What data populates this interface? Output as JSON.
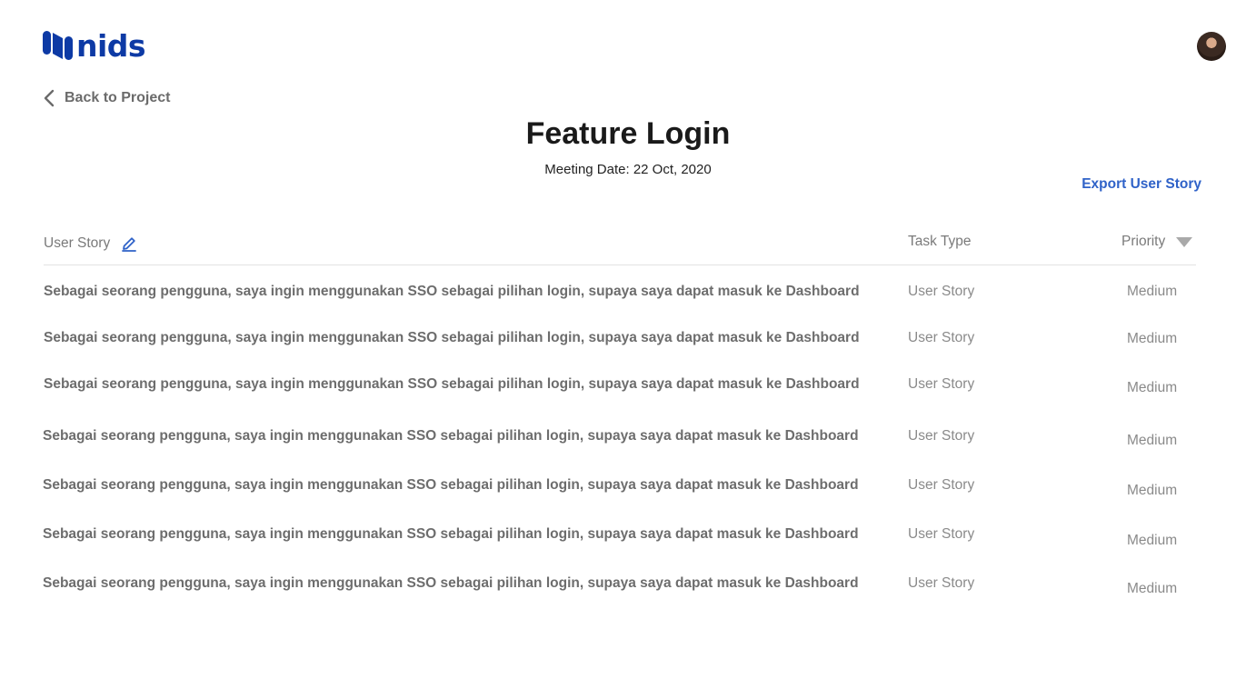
{
  "brand": {
    "name": "nids",
    "color": "#0d3aa5"
  },
  "nav": {
    "back_label": "Back to Project"
  },
  "page": {
    "title": "Feature Login",
    "meeting_date": "Meeting Date: 22 Oct, 2020"
  },
  "actions": {
    "export_label": "Export User Story",
    "accent": "#2f62c8"
  },
  "table": {
    "columns": {
      "story": "User Story",
      "type": "Task Type",
      "priority": "Priority"
    },
    "rows": [
      {
        "story": "Sebagai seorang pengguna, saya ingin menggunakan SSO sebagai pilihan login, supaya saya dapat masuk ke Dashboard",
        "type": "User Story",
        "priority": "Medium"
      },
      {
        "story": "Sebagai seorang pengguna, saya ingin menggunakan SSO sebagai pilihan login, supaya saya dapat masuk ke Dashboard",
        "type": "User Story",
        "priority": "Medium"
      },
      {
        "story": "Sebagai seorang pengguna, saya ingin menggunakan SSO sebagai pilihan login, supaya saya dapat masuk ke Dashboard",
        "type": "User Story",
        "priority": "Medium"
      },
      {
        "story": "Sebagai seorang pengguna, saya ingin menggunakan SSO sebagai pilihan login, supaya saya dapat masuk ke Dashboard",
        "type": "User Story",
        "priority": "Medium"
      },
      {
        "story": "Sebagai seorang pengguna, saya ingin menggunakan SSO sebagai pilihan login, supaya saya dapat masuk ke Dashboard",
        "type": "User Story",
        "priority": "Medium"
      },
      {
        "story": "Sebagai seorang pengguna, saya ingin menggunakan SSO sebagai pilihan login, supaya saya dapat masuk ke Dashboard",
        "type": "User Story",
        "priority": "Medium"
      },
      {
        "story": "Sebagai seorang pengguna, saya ingin menggunakan SSO sebagai pilihan login, supaya saya dapat masuk ke Dashboard",
        "type": "User Story",
        "priority": "Medium"
      }
    ]
  },
  "icons": [
    "logo-mark-icon",
    "avatar",
    "chevron-left-icon",
    "pencil-icon",
    "caret-down-icon"
  ]
}
